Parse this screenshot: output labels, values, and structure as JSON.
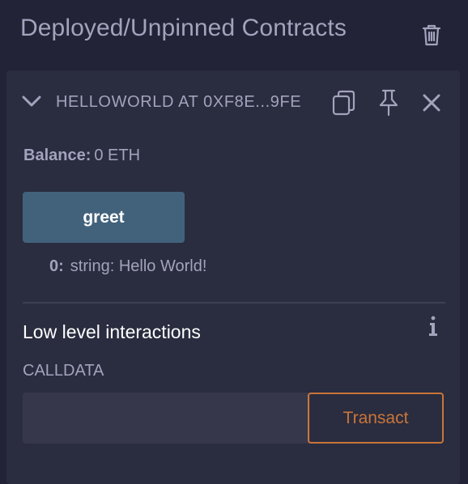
{
  "header": {
    "title": "Deployed/Unpinned Contracts",
    "clear_icon": "trash-icon"
  },
  "contract": {
    "name": "HELLOWORLD AT 0XF8E...9FE",
    "expand_icon": "chevron-down-icon",
    "copy_icon": "copy-icon",
    "pin_icon": "pin-icon",
    "close_icon": "close-icon",
    "balance_label": "Balance:",
    "balance_value": "0 ETH",
    "functions": [
      {
        "label": "greet"
      }
    ],
    "output": {
      "index": "0:",
      "value": "string: Hello World!"
    },
    "low_level": {
      "title": "Low level interactions",
      "info_icon": "info-icon",
      "calldata_label": "CALLDATA",
      "calldata_value": "",
      "transact_label": "Transact"
    }
  },
  "colors": {
    "background": "#222336",
    "card": "#2a2c3f",
    "text": "#a2a3bd",
    "greet_button": "#42627c",
    "transact_accent": "#c97539"
  }
}
